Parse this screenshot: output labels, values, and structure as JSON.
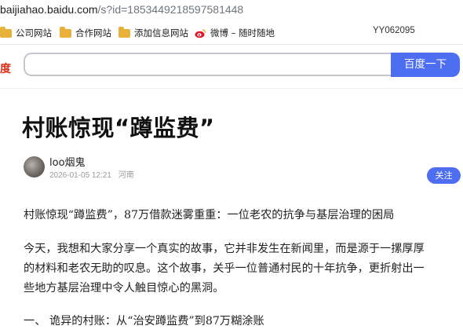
{
  "browser": {
    "url_host": "baijiahao.baidu.com",
    "url_path": "/s?id=1853449218597581448",
    "bookmarks": [
      {
        "label": "公司网站",
        "icon": "folder-icon"
      },
      {
        "label": "合作网站",
        "icon": "folder-icon"
      },
      {
        "label": "添加信息网站",
        "icon": "folder-icon"
      },
      {
        "label": "微博 – 随时随地",
        "icon": "weibo-icon"
      }
    ],
    "right_label": "YY062095"
  },
  "search": {
    "logo_fragment": "度",
    "query": "",
    "button_label": "百度一下"
  },
  "article": {
    "title": "村账惊现“蹲监费”",
    "author": "loo烟鬼",
    "date": "2026-01-05 12:21",
    "location": "河南",
    "follow_label": "关注",
    "paragraphs": [
      "村账惊现“蹲监费”，87万借款迷雾重重：一位老农的抗争与基层治理的困局",
      "今天，我想和大家分享一个真实的故事，它并非发生在新闻里，而是源于一摞厚厚",
      "的材料和老农无助的叹息。这个故事，关乎一位普通村民的十年抗争，更折射出一",
      "些地方基层治理中令人触目惊心的黑洞。",
      "一、 诡异的村账：从“治安蹲监费”到87万糊涂账"
    ]
  },
  "colors": {
    "accent": "#4e6ef2",
    "logo_red": "#de2e18",
    "folder": "#e8b13a"
  }
}
